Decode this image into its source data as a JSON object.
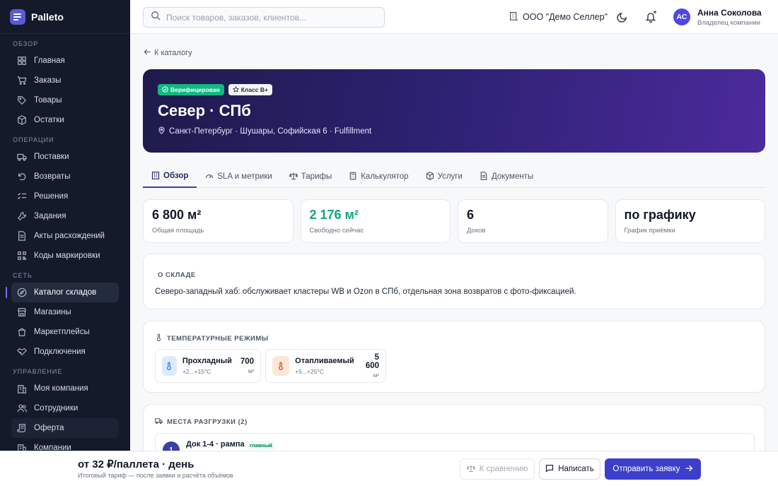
{
  "app": {
    "name": "Palleto"
  },
  "sidebar": {
    "sections": [
      {
        "title": "ОБЗОР",
        "items": [
          {
            "label": "Главная",
            "icon": "grid-icon"
          },
          {
            "label": "Заказы",
            "icon": "cart-icon"
          },
          {
            "label": "Товары",
            "icon": "tag-icon"
          },
          {
            "label": "Остатки",
            "icon": "box-icon"
          }
        ]
      },
      {
        "title": "ОПЕРАЦИИ",
        "items": [
          {
            "label": "Поставки",
            "icon": "truck-icon"
          },
          {
            "label": "Возвраты",
            "icon": "return-icon"
          },
          {
            "label": "Решения",
            "icon": "list-check-icon"
          },
          {
            "label": "Задания",
            "icon": "wrench-icon"
          },
          {
            "label": "Акты расхождений",
            "icon": "document-icon"
          },
          {
            "label": "Коды маркировки",
            "icon": "qr-icon"
          }
        ]
      },
      {
        "title": "СЕТЬ",
        "items": [
          {
            "label": "Каталог складов",
            "icon": "compass-icon",
            "active": true
          },
          {
            "label": "Магазины",
            "icon": "store-icon"
          },
          {
            "label": "Маркетплейсы",
            "icon": "bag-icon"
          },
          {
            "label": "Подключения",
            "icon": "handshake-icon"
          }
        ]
      },
      {
        "title": "УПРАВЛЕНИЕ",
        "items": [
          {
            "label": "Моя компания",
            "icon": "building-icon"
          },
          {
            "label": "Сотрудники",
            "icon": "users-icon"
          },
          {
            "label": "Оферта",
            "icon": "scroll-icon"
          },
          {
            "label": "Компании",
            "icon": "building-icon"
          }
        ]
      }
    ]
  },
  "header": {
    "search_placeholder": "Поиск товаров, заказов, клиентов...",
    "company": "ООО \"Демо Селлер\"",
    "user": {
      "initials": "АС",
      "name": "Анна Соколова",
      "role": "Владелец компании"
    }
  },
  "main": {
    "back_label": "К каталогу",
    "hero": {
      "badge_verified": "Верифицирован",
      "badge_class": "Класс B+",
      "title": "Север · СПб",
      "address": "Санкт-Петербург · Шушары, Софийская 6 · Fulfillment"
    },
    "tabs": [
      {
        "label": "Обзор",
        "icon": "building-icon",
        "active": true
      },
      {
        "label": "SLA и метрики",
        "icon": "gauge-icon"
      },
      {
        "label": "Тарифы",
        "icon": "scale-icon"
      },
      {
        "label": "Калькулятор",
        "icon": "calculator-icon"
      },
      {
        "label": "Услуги",
        "icon": "box-icon"
      },
      {
        "label": "Документы",
        "icon": "document-icon"
      }
    ],
    "stats": [
      {
        "value": "6 800 м²",
        "label": "Общая площадь"
      },
      {
        "value": "2 176 м²",
        "label": "Свободно сейчас",
        "accent": "#10a37f"
      },
      {
        "value": "6",
        "label": "Доков"
      },
      {
        "value": "по графику",
        "label": "График приёмки"
      }
    ],
    "about": {
      "title": "О СКЛАДЕ",
      "text": "Северо-западный хаб: обслуживает кластеры WB и Ozon в СПб, отдельная зона возвратов с фото-фиксацией."
    },
    "temperature": {
      "title": "ТЕМПЕРАТУРНЫЕ РЕЖИМЫ",
      "zones": [
        {
          "name": "Прохладный",
          "range": "+2...+15°C",
          "value": "700",
          "unit": "м²",
          "color": "#dbeafe"
        },
        {
          "name": "Отапливаемый",
          "range": "+5...+25°C",
          "value": "5 600",
          "unit": "м²",
          "color": "#fde7d6"
        }
      ]
    },
    "docks": {
      "title": "МЕСТА РАЗГРУЗКИ (2)",
      "items": [
        {
          "num": "1",
          "name": "Док 1-4 · рампа",
          "tag": "главный"
        }
      ]
    }
  },
  "bottom": {
    "price": "от 32 ₽/паллета · день",
    "note": "Итоговый тариф — после заявки и расчёта объёмов",
    "compare_label": "К сравнению",
    "write_label": "Написать",
    "send_label": "Отправить заявку"
  },
  "colors": {
    "accent": "#3b3fc9",
    "sidebar_bg": "#141a2a",
    "success": "#10b981"
  }
}
